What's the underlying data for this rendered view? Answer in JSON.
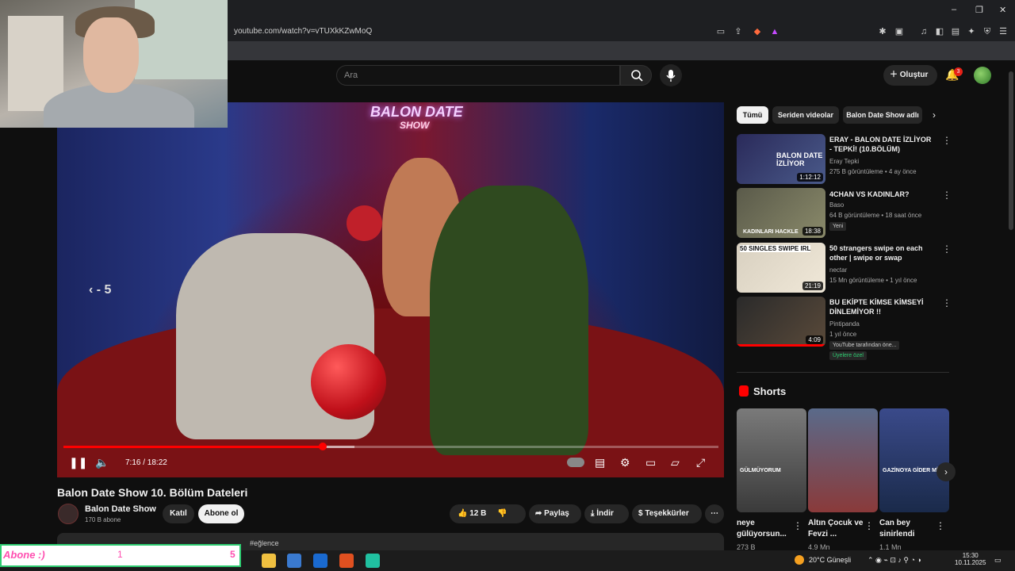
{
  "browser": {
    "url": "youtube.com/watch?v=vTUXkKZwMoQ",
    "icons": [
      "tab-search-icon",
      "cast-icon",
      "share-icon",
      "brave-shield-icon",
      "rewards-icon",
      "extensions-icon",
      "media-icon",
      "sidebar-icon",
      "wallet-icon",
      "leo-icon",
      "vpn-icon",
      "menu-icon"
    ]
  },
  "header": {
    "search_placeholder": "Ara",
    "create_label": "Oluştur",
    "notif_count": "3"
  },
  "player": {
    "seek_hint": "‹  - 5",
    "time": "7:16 / 18:22",
    "progress": 0.396,
    "buffered": 0.444,
    "neon_line1": "BALON DATE",
    "neon_line2": "SHOW"
  },
  "video": {
    "title": "Balon Date Show 10. Bölüm Dateleri",
    "channel": "Balon Date Show",
    "subs": "170 B abone",
    "join": "Katıl",
    "subscribe": "Abone ol",
    "likes": "12 B",
    "share": "Paylaş",
    "download": "İndir",
    "thanks": "Teşekkürler",
    "desc_tag": "#eğlence"
  },
  "chips": [
    "Tümü",
    "Seriden videolar",
    "Balon Date Show adlı"
  ],
  "recommendations": [
    {
      "title": "ERAY - BALON DATE İZLİYOR - TEPKİ! (10.BÖLÜM)",
      "channel": "Eray Tepki",
      "meta": "275 B görüntüleme • 4 ay önce",
      "duration": "1:12:12",
      "thumb_text": "BALON DATE İZLİYOR",
      "badge": ""
    },
    {
      "title": "4CHAN VS KADINLAR?",
      "channel": "Baso",
      "meta": "64 B görüntüleme • 18 saat önce",
      "duration": "18:38",
      "thumb_text": "KADINLARI HACKLE",
      "badge": "Yeni"
    },
    {
      "title": "50 strangers swipe on each other | swipe or swap",
      "channel": "nectar",
      "meta": "15 Mn görüntüleme • 1 yıl önce",
      "duration": "21:19",
      "thumb_text": "50 SINGLES SWIPE IRL",
      "badge": ""
    },
    {
      "title": "BU EKİPTE KİMSE KİMSEYİ DİNLEMİYOR !!",
      "channel": "Pintipanda",
      "meta": "1 yıl önce",
      "duration": "4:09",
      "thumb_text": "",
      "badge": "YouTube tarafından öne...",
      "badge2": "Üyelere özel"
    }
  ],
  "shorts": {
    "label": "Shorts",
    "items": [
      {
        "title": "neye gülüyorsun...",
        "views": "273 B",
        "caption": "GÜLMÜYORUM"
      },
      {
        "title": "Altın Çocuk ve Fevzi ...",
        "views": "4.9 Mn",
        "caption": ""
      },
      {
        "title": "Can bey sinirlendi",
        "views": "1.1 Mn",
        "caption": "GAZİNOYA GİDER Mİ"
      }
    ]
  },
  "overlay": {
    "abone_label": "Abone :)",
    "abone_current": "1",
    "abone_goal": "5"
  },
  "taskbar": {
    "weather": "20°C  Güneşli",
    "time": "15:30",
    "date": "10.11.2025"
  },
  "colors": {
    "accent_red": "#ff0000",
    "bg": "#0f0f0f",
    "chip_active": "#f1f1f1"
  }
}
